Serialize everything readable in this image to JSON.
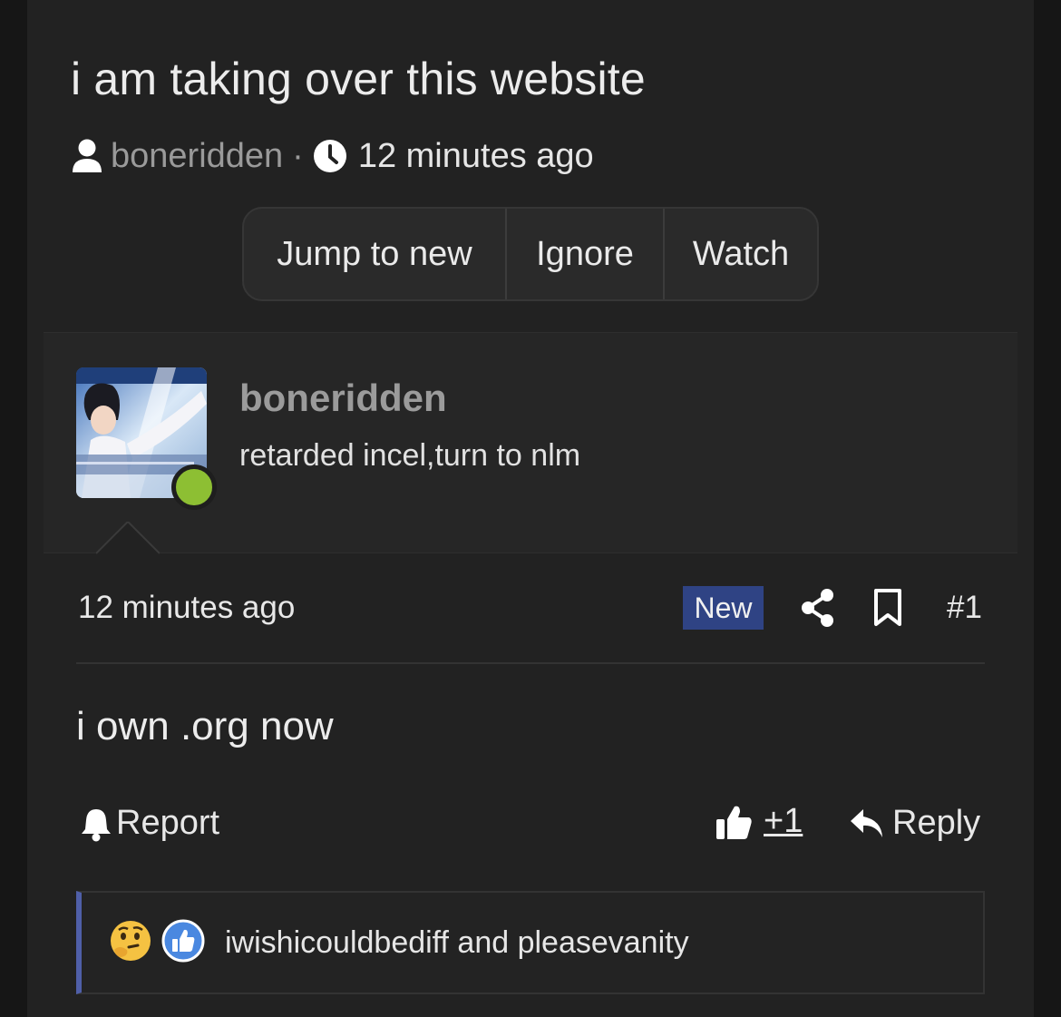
{
  "thread": {
    "title": "i am taking over this website",
    "author": "boneridden",
    "separator": "·",
    "time": "12 minutes ago"
  },
  "thread_actions": {
    "jump_label": "Jump to new",
    "ignore_label": "Ignore",
    "watch_label": "Watch"
  },
  "post": {
    "username": "boneridden",
    "user_title": "retarded incel,turn to nlm",
    "online_color": "#8dbf33",
    "time": "12 minutes ago",
    "badge": "New",
    "badge_color": "#2f4384",
    "number": "#1",
    "body": "i own .org now",
    "report_label": "Report",
    "reaction_count": "+1",
    "reply_label": "Reply"
  },
  "reactions": {
    "icons": [
      "thinking-emoji-icon",
      "like-reaction-icon"
    ],
    "users": "iwishicouldbediff and pleasevanity",
    "accent_color": "#4f5fa8"
  }
}
